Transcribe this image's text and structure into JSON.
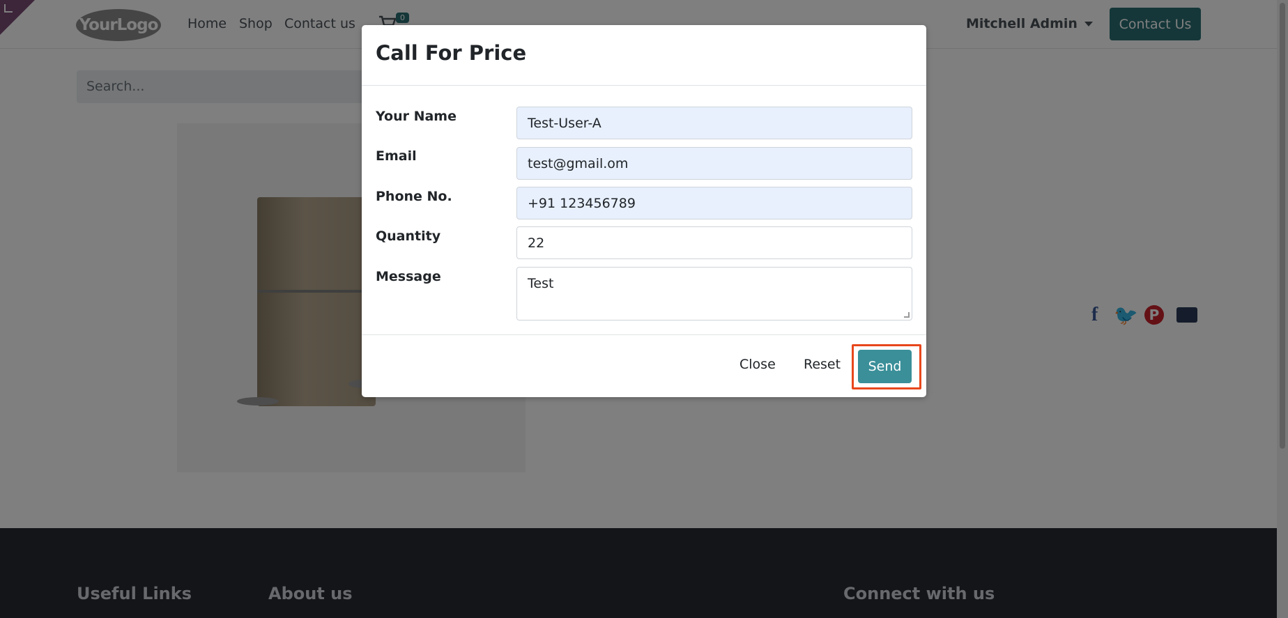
{
  "navbar": {
    "logo_text": "YourLogo",
    "links": [
      "Home",
      "Shop",
      "Contact us"
    ],
    "cart_count": "0",
    "user_name": "Mitchell Admin",
    "contact_button": "Contact Us"
  },
  "search": {
    "placeholder": "Search..."
  },
  "footer": {
    "headings": [
      "Useful Links",
      "About us",
      "Connect with us"
    ]
  },
  "modal": {
    "title": "Call For Price",
    "fields": [
      {
        "label": "Your Name",
        "value": "Test-User-A"
      },
      {
        "label": "Email",
        "value": "test@gmail.om"
      },
      {
        "label": "Phone No.",
        "value": "+91 123456789"
      },
      {
        "label": "Quantity",
        "value": "22"
      },
      {
        "label": "Message",
        "value": "Test"
      }
    ],
    "buttons": {
      "close": "Close",
      "reset": "Reset",
      "send": "Send"
    }
  },
  "social": {
    "pinterest_glyph": "P",
    "facebook_glyph": "f",
    "twitter_glyph": "🐦"
  },
  "colors": {
    "accent": "#2b6e73",
    "send": "#3a8f99",
    "highlight": "#e8471d",
    "footer": "#262a33"
  }
}
